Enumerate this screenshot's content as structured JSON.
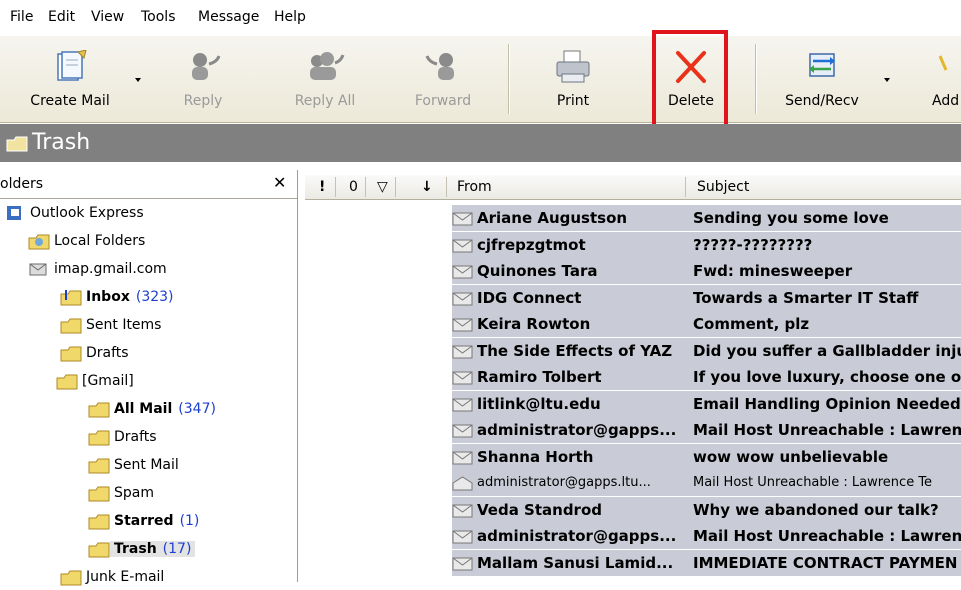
{
  "menu": [
    "File",
    "Edit",
    "View",
    "Tools",
    "Message",
    "Help"
  ],
  "toolbar": {
    "buttons": [
      {
        "label": "Create Mail",
        "icon": "create-mail-icon",
        "disabled": false
      },
      {
        "label": "Reply",
        "icon": "reply-icon",
        "disabled": true
      },
      {
        "label": "Reply All",
        "icon": "reply-all-icon",
        "disabled": true
      },
      {
        "label": "Forward",
        "icon": "forward-icon",
        "disabled": true
      },
      {
        "label": "Print",
        "icon": "printer-icon",
        "disabled": false
      },
      {
        "label": "Delete",
        "icon": "delete-x-icon",
        "disabled": false
      },
      {
        "label": "Send/Recv",
        "icon": "send-receive-icon",
        "disabled": false
      },
      {
        "label": "Add",
        "icon": "address-book-icon",
        "disabled": false
      }
    ],
    "highlight_color": "#e0141c"
  },
  "title": "Trash",
  "folders": {
    "header": "olders",
    "close": "✕",
    "tree": [
      {
        "name": "Outlook Express",
        "count": "",
        "bold": false
      },
      {
        "name": "Local Folders",
        "count": "",
        "bold": false
      },
      {
        "name": "imap.gmail.com",
        "count": "",
        "bold": false
      },
      {
        "name": "Inbox",
        "count": "(323)",
        "bold": true
      },
      {
        "name": "Sent Items",
        "count": "",
        "bold": false
      },
      {
        "name": "Drafts",
        "count": "",
        "bold": false
      },
      {
        "name": "[Gmail]",
        "count": "",
        "bold": false
      },
      {
        "name": "All Mail",
        "count": "(347)",
        "bold": true
      },
      {
        "name": "Drafts",
        "count": "",
        "bold": false
      },
      {
        "name": "Sent Mail",
        "count": "",
        "bold": false
      },
      {
        "name": "Spam",
        "count": "",
        "bold": false
      },
      {
        "name": "Starred",
        "count": "(1)",
        "bold": true
      },
      {
        "name": "Trash",
        "count": "(17)",
        "bold": true
      },
      {
        "name": "Junk E-mail",
        "count": "",
        "bold": false
      }
    ]
  },
  "columns": {
    "priority": "!",
    "attach": "0",
    "flag": "▽",
    "sort": "↓",
    "from": "From",
    "subject": "Subject"
  },
  "messages": [
    {
      "from": "Ariane Augustson",
      "subject": "Sending you some love",
      "unread": true
    },
    {
      "from": "cjfrepzgtmot",
      "subject": "?????-????????",
      "unread": true
    },
    {
      "from": "Quinones Tara",
      "subject": "Fwd: minesweeper",
      "unread": true
    },
    {
      "from": "IDG Connect",
      "subject": "Towards a Smarter IT Staff",
      "unread": true
    },
    {
      "from": "Keira Rowton",
      "subject": "Comment, plz",
      "unread": true
    },
    {
      "from": "The Side Effects of YAZ",
      "subject": "Did you suffer a Gallbladder inju",
      "unread": true
    },
    {
      "from": "Ramiro Tolbert",
      "subject": "If you love luxury, choose one o",
      "unread": true
    },
    {
      "from": "litlink@ltu.edu",
      "subject": "Email Handling Opinion Needed",
      "unread": true
    },
    {
      "from": "administrator@gapps...",
      "subject": "Mail Host Unreachable : Lawren",
      "unread": true
    },
    {
      "from": "Shanna Horth",
      "subject": "wow wow unbelievable",
      "unread": true
    },
    {
      "from": "administrator@gapps.ltu...",
      "subject": "Mail Host Unreachable : Lawrence Te",
      "unread": false
    },
    {
      "from": "Veda Standrod",
      "subject": "Why we abandoned our talk?",
      "unread": true
    },
    {
      "from": "administrator@gapps...",
      "subject": "Mail Host Unreachable : Lawren",
      "unread": true
    },
    {
      "from": "Mallam Sanusi Lamid...",
      "subject": "IMMEDIATE CONTRACT PAYMEN",
      "unread": true
    }
  ]
}
